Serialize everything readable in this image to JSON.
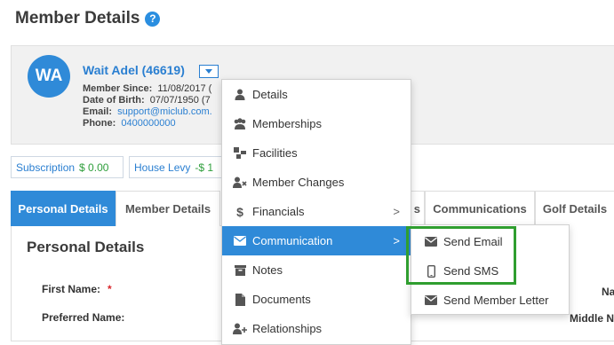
{
  "page": {
    "title": "Member Details",
    "help_icon": "?"
  },
  "member": {
    "initials": "WA",
    "name": "Wait Adel (46619)",
    "member_since_label": "Member Since:",
    "member_since": "11/08/2017 (",
    "dob_label": "Date of Birth:",
    "dob": "07/07/1950 (7",
    "email_label": "Email:",
    "email": "support@miclub.com.",
    "phone_label": "Phone:",
    "phone": "0400000000"
  },
  "badges": [
    {
      "label": "Subscription",
      "value": "$ 0.00"
    },
    {
      "label": "House Levy",
      "value": "-$ 1"
    }
  ],
  "tabs": [
    {
      "label": "Personal Details"
    },
    {
      "label": "Member Details"
    },
    {
      "label": "s"
    },
    {
      "label": "Communications"
    },
    {
      "label": "Golf Details"
    }
  ],
  "content": {
    "section_title": "Personal Details",
    "first_name_label": "First Name:",
    "required_mark": "*",
    "preferred_name_label": "Preferred Name:",
    "right_clip_1": "Name",
    "right_clip_2": "Middle N"
  },
  "menu": {
    "items": [
      {
        "label": "Details",
        "icon": "user-icon"
      },
      {
        "label": "Memberships",
        "icon": "users-icon"
      },
      {
        "label": "Facilities",
        "icon": "sitemap-icon"
      },
      {
        "label": "Member Changes",
        "icon": "user-times-icon"
      },
      {
        "label": "Financials",
        "icon": "dollar-icon",
        "arrow": ">"
      },
      {
        "label": "Communication",
        "icon": "envelope-icon",
        "arrow": ">"
      },
      {
        "label": "Notes",
        "icon": "archive-icon"
      },
      {
        "label": "Documents",
        "icon": "file-icon"
      },
      {
        "label": "Relationships",
        "icon": "user-plus-icon"
      }
    ],
    "active_item": "Communication"
  },
  "submenu": {
    "items": [
      {
        "label": "Send Email",
        "icon": "envelope-icon"
      },
      {
        "label": "Send SMS",
        "icon": "mobile-icon"
      },
      {
        "label": "Send Member Letter",
        "icon": "envelope-icon"
      }
    ]
  },
  "colors": {
    "accent": "#2f8ad8",
    "link": "#2a7fd1",
    "money": "#2e9e3b",
    "highlight": "#2f9e2f"
  }
}
